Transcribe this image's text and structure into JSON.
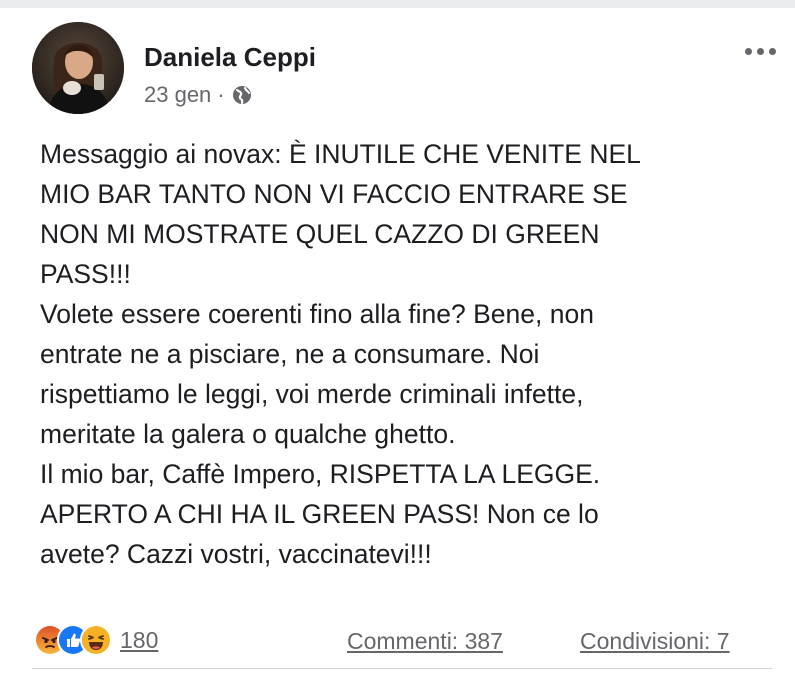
{
  "post": {
    "author": "Daniela Ceppi",
    "date": "23 gen",
    "separator": "·",
    "privacy_icon": "globe-icon",
    "more_icon": "more-options-icon",
    "text_lines": [
      "Messaggio ai novax: È INUTILE CHE VENITE NEL",
      "MIO BAR TANTO NON VI FACCIO ENTRARE SE",
      "NON MI MOSTRATE QUEL CAZZO DI GREEN",
      "PASS!!!",
      "Volete essere coerenti fino alla fine? Bene, non",
      "entrate ne a pisciare, ne a consumare. Noi",
      "rispettiamo le leggi, voi merde criminali infette,",
      "meritate la galera o qualche ghetto.",
      "Il mio bar, Caffè Impero, RISPETTA LA LEGGE.",
      "APERTO A CHI HA IL GREEN PASS! Non ce lo",
      "avete? Cazzi vostri, vaccinatevi!!!"
    ]
  },
  "footer": {
    "reactions": [
      "angry-reaction-icon",
      "like-reaction-icon",
      "haha-reaction-icon"
    ],
    "reaction_count": "180",
    "comments": "Commenti: 387",
    "shares": "Condivisioni: 7"
  },
  "colors": {
    "text": "#1c1e21",
    "secondary": "#65676b",
    "like_blue": "#1877f2",
    "angry_orange": "#e9710f",
    "haha_yellow": "#f7b125"
  }
}
